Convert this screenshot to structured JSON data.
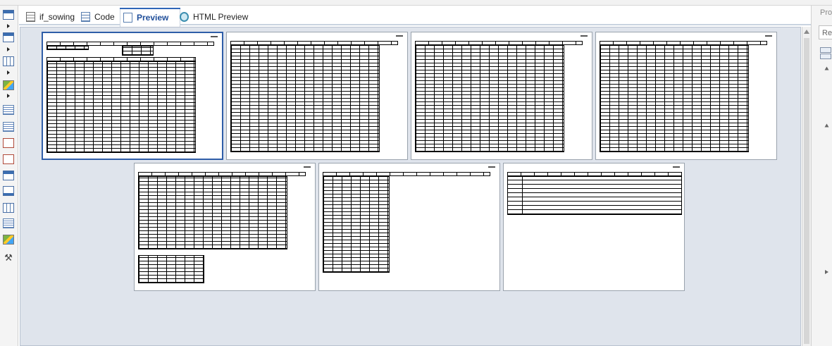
{
  "tabs": [
    {
      "label": "if_sowing",
      "icon": "document-icon"
    },
    {
      "label": "Code",
      "icon": "code-icon"
    },
    {
      "label": "Preview",
      "icon": "preview-icon",
      "active": true
    },
    {
      "label": "HTML Preview",
      "icon": "html-preview-icon"
    }
  ],
  "properties_panel": {
    "title": "Prop",
    "input_value": "Re"
  },
  "palette": {
    "tools": [
      "header-band-icon",
      "header-band-icon",
      "group-icon",
      "image-icon",
      "document-icon",
      "document-icon",
      "textfield-icon",
      "textfield-icon",
      "page-header-icon",
      "page-footer-icon",
      "table-icon",
      "text-icon",
      "image-icon",
      "tools-icon"
    ]
  },
  "preview": {
    "page_count": 7,
    "selected_page": 1
  }
}
